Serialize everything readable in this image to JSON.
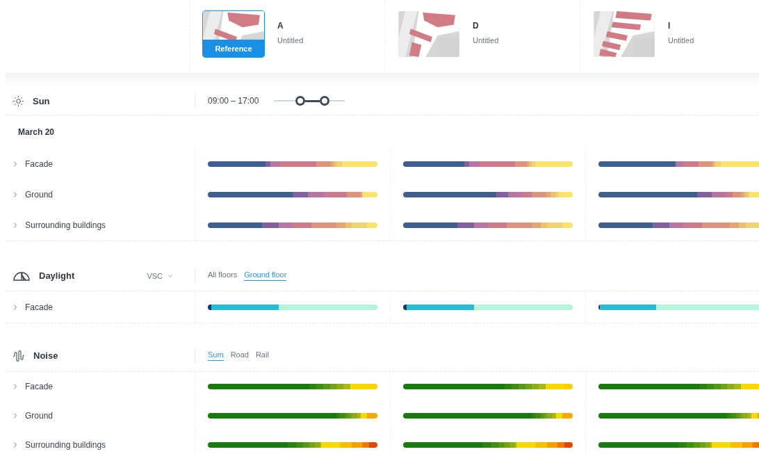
{
  "columns": [
    {
      "letter": "A",
      "subtitle": "Untitled",
      "badge": "Reference",
      "selected": true
    },
    {
      "letter": "D",
      "subtitle": "Untitled",
      "selected": false
    },
    {
      "letter": "I",
      "subtitle": "Untitled",
      "selected": false
    }
  ],
  "sections": [
    {
      "kind": "sun",
      "title": "Sun",
      "time_range": "09:00 – 17:00",
      "handles": [
        {
          "level": 0.37
        },
        {
          "level": 0.71
        }
      ],
      "date": "March 20",
      "rows": [
        {
          "label": "Facade",
          "expanded": false
        },
        {
          "label": "Ground",
          "expanded": false
        },
        {
          "label": "Surrounding buildings",
          "expanded": false
        }
      ]
    },
    {
      "kind": "daylight",
      "title": "Daylight",
      "dropdown": "VSC",
      "tabs": [
        {
          "label": "All floors",
          "selected": false
        },
        {
          "label": "Ground floor",
          "selected": true
        }
      ],
      "rows": [
        {
          "label": "Facade",
          "expanded": false
        }
      ]
    },
    {
      "kind": "noise",
      "title": "Noise",
      "tabs": [
        {
          "label": "Sum",
          "selected": true
        },
        {
          "label": "Road",
          "selected": false
        },
        {
          "label": "Rail",
          "selected": false
        }
      ],
      "rows": [
        {
          "label": "Facade",
          "expanded": false
        },
        {
          "label": "Ground",
          "expanded": false
        },
        {
          "label": "Surrounding buildings",
          "expanded": false
        }
      ]
    }
  ]
}
